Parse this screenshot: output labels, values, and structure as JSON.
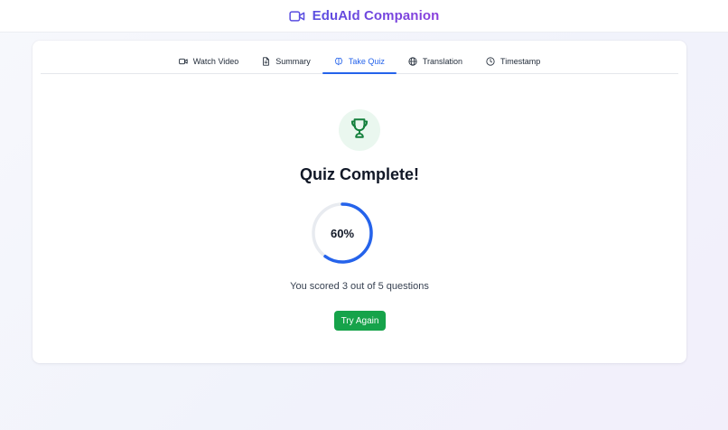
{
  "app": {
    "title": "EduAId Companion",
    "icon": "video-camera-icon",
    "accent_start": "#5a4ee0",
    "accent_end": "#8a3fdc"
  },
  "tabs": [
    {
      "label": "Watch Video",
      "icon": "video-camera-icon",
      "active": false
    },
    {
      "label": "Summary",
      "icon": "document-icon",
      "active": false
    },
    {
      "label": "Take Quiz",
      "icon": "brain-icon",
      "active": true
    },
    {
      "label": "Translation",
      "icon": "globe-icon",
      "active": false
    },
    {
      "label": "Timestamp",
      "icon": "clock-icon",
      "active": false
    }
  ],
  "quiz_result": {
    "icon": "trophy-icon",
    "title": "Quiz Complete!",
    "percent_label": "60%",
    "percent_value": 0.6,
    "score_text": "You scored 3 out of 5 questions",
    "retry_label": "Try Again"
  },
  "colors": {
    "tab_active": "#2563eb",
    "progress": "#2563eb",
    "success": "#16a34a",
    "trophy": "#15803d"
  }
}
